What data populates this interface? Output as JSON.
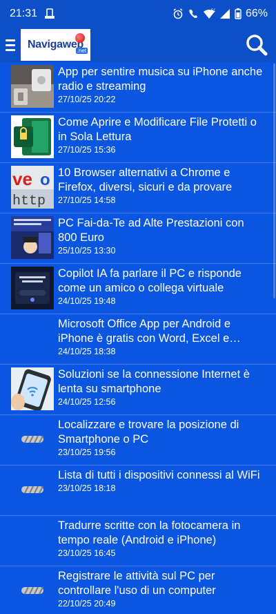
{
  "status_bar": {
    "time": "21:31",
    "battery": "66%"
  },
  "app_bar": {
    "logo_text": "Navigaweb",
    "logo_suffix": ".net"
  },
  "articles": [
    {
      "title": "App per sentire musica su iPhone anche radio e streaming",
      "date": "27/10/25 20:22"
    },
    {
      "title": "Come Aprire e Modificare File Protetti o in Sola Lettura",
      "date": "27/10/25 15:36"
    },
    {
      "title": "10 Browser alternativi a Chrome e Firefox, diversi, sicuri e da provare",
      "date": "27/10/25 14:58"
    },
    {
      "title": "PC Fai-da-Te ad Alte Prestazioni con 800 Euro",
      "date": "25/10/25 13:30"
    },
    {
      "title": "Copilot IA fa parlare il PC e risponde come un amico o collega virtuale",
      "date": "24/10/25 19:48"
    },
    {
      "title": "Microsoft Office App per Android e iPhone è gratis con Word, Excel e Powerpoint",
      "date": "24/10/25 18:38"
    },
    {
      "title": "Soluzioni se la connessione Internet è lenta su smartphone",
      "date": "24/10/25 12:56"
    },
    {
      "title": "Localizzare e trovare la posizione di Smartphone o PC",
      "date": "23/10/25 19:56"
    },
    {
      "title": "Lista di tutti i dispositivi connessi al WiFi",
      "date": "23/10/25 18:18"
    },
    {
      "title": "Tradurre scritte con la fotocamera in tempo reale (Android e iPhone)",
      "date": "23/10/25 16:45"
    },
    {
      "title": "Registrare le attività sul PC per controllare l'uso di un computer",
      "date": "22/10/25 20:49"
    }
  ]
}
